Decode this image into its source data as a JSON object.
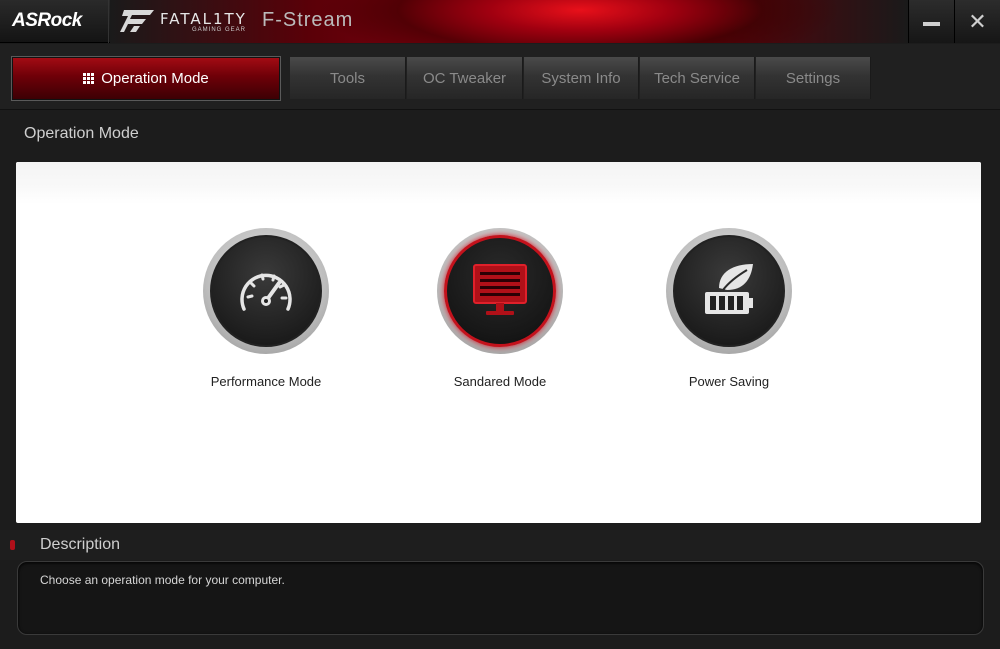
{
  "titlebar": {
    "brand": "ASRock",
    "fatality_label": "FATAL1TY",
    "fatality_sub": "GAMING GEAR",
    "app_title": "F-Stream",
    "minimize_icon": "minimize-icon",
    "close_icon": "close-icon",
    "close_glyph": "✕"
  },
  "tabs": {
    "active": {
      "label": "Operation Mode",
      "icon": "grid-icon"
    },
    "items": [
      {
        "label": "Tools"
      },
      {
        "label": "OC Tweaker"
      },
      {
        "label": "System Info"
      },
      {
        "label": "Tech Service"
      },
      {
        "label": "Settings"
      }
    ]
  },
  "main": {
    "section_title": "Operation Mode",
    "modes": [
      {
        "label": "Performance Mode",
        "icon": "speedometer-icon",
        "selected": false
      },
      {
        "label": "Sandared Mode",
        "icon": "monitor-icon",
        "selected": true
      },
      {
        "label": "Power Saving",
        "icon": "leaf-battery-icon",
        "selected": false
      }
    ]
  },
  "description": {
    "title": "Description",
    "text": "Choose an operation mode for your computer."
  },
  "colors": {
    "accent_red": "#c4121c",
    "background": "#1c1c1c",
    "panel": "#ffffff"
  }
}
